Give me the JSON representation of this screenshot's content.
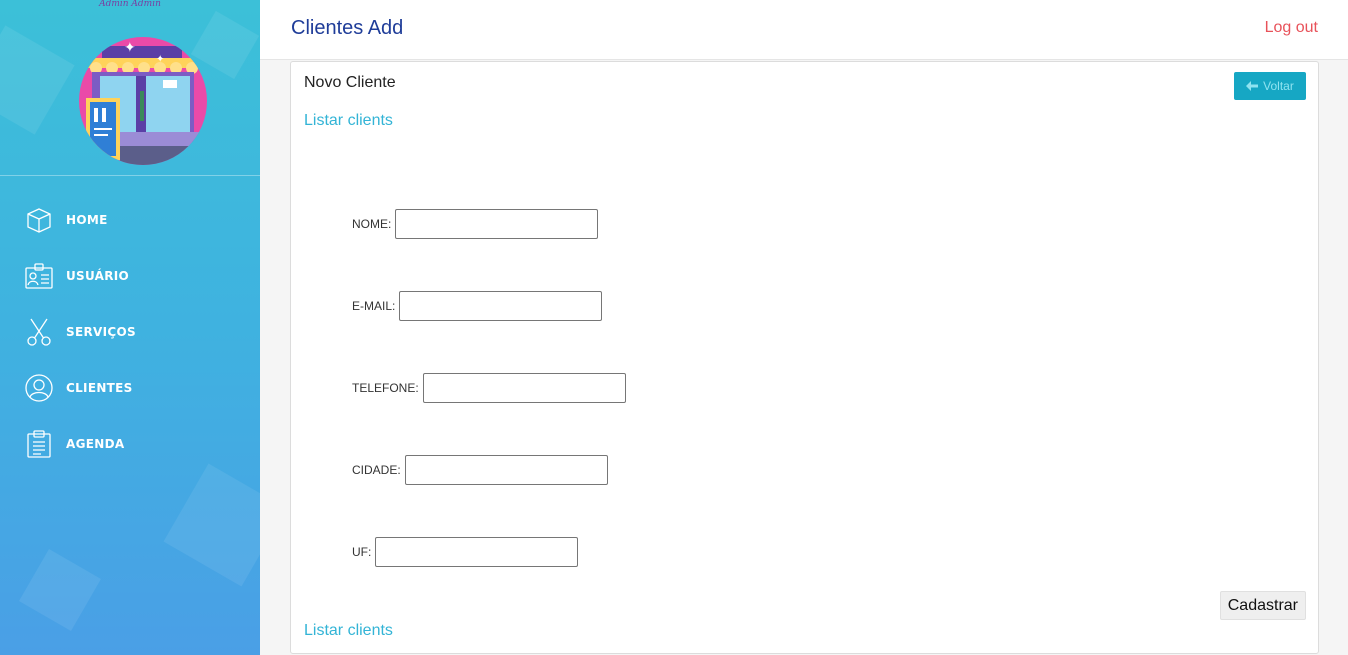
{
  "sidebar": {
    "admin_name": "Admin Admin",
    "items": [
      {
        "label": "HOME",
        "icon": "box-icon"
      },
      {
        "label": "USUÁRIO",
        "icon": "id-card-icon"
      },
      {
        "label": "SERVIÇOS",
        "icon": "scissors-icon"
      },
      {
        "label": "CLIENTES",
        "icon": "user-circle-icon"
      },
      {
        "label": "AGENDA",
        "icon": "clipboard-icon"
      }
    ]
  },
  "header": {
    "title": "Clientes Add",
    "logout_label": "Log out"
  },
  "card": {
    "title": "Novo Cliente",
    "back_label": "Voltar",
    "list_link_top": "Listar clients",
    "list_link_bottom": "Listar clients",
    "submit_label": "Cadastrar"
  },
  "form": {
    "nome": {
      "label": "NOME:",
      "value": ""
    },
    "email": {
      "label": "E-MAIL:",
      "value": ""
    },
    "telefone": {
      "label": "TELEFONE:",
      "value": ""
    },
    "cidade": {
      "label": "CIDADE:",
      "value": ""
    },
    "uf": {
      "label": "UF:",
      "value": ""
    }
  },
  "colors": {
    "title": "#1f3d99",
    "logout": "#e8525a",
    "link": "#33b4d6",
    "back_button": "#16a7c4"
  }
}
